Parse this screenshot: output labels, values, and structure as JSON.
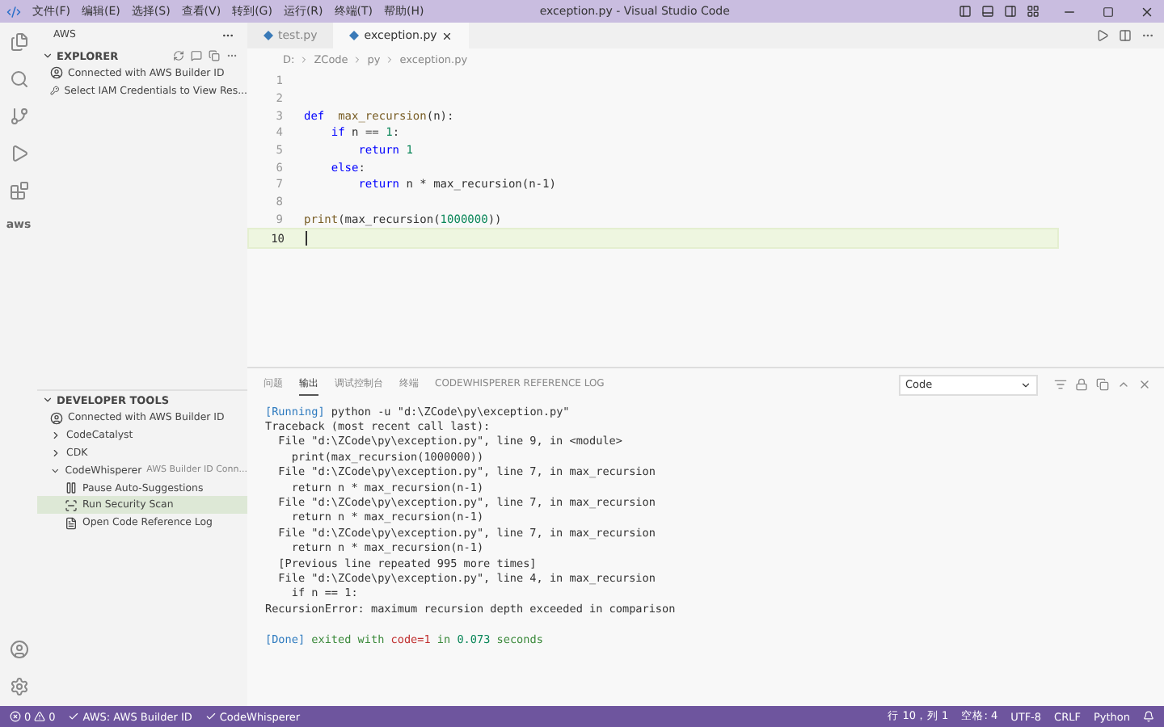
{
  "title_bar": {
    "menus": [
      "文件(F)",
      "编辑(E)",
      "选择(S)",
      "查看(V)",
      "转到(G)",
      "运行(R)",
      "终端(T)",
      "帮助(H)"
    ],
    "title": "exception.py - Visual Studio Code"
  },
  "activity_bar": {
    "aws_label": "aws"
  },
  "sidebar": {
    "title": "AWS",
    "sections": [
      {
        "title": "EXPLORER",
        "expanded": true,
        "items": [
          {
            "kind": "person",
            "label": "Connected with AWS Builder ID",
            "selected": false
          },
          {
            "kind": "key",
            "label": "Select IAM Credentials to View Res...",
            "selected": false
          }
        ]
      },
      {
        "title": "DEVELOPER TOOLS",
        "expanded": true,
        "items": [
          {
            "kind": "person",
            "label": "Connected with AWS Builder ID",
            "selected": false
          },
          {
            "kind": "group",
            "label": "CodeCatalyst",
            "expanded": false,
            "selected": false
          },
          {
            "kind": "group",
            "label": "CDK",
            "expanded": false,
            "selected": false
          },
          {
            "kind": "group",
            "label": "CodeWhisperer",
            "description": "AWS Builder ID Conn...",
            "expanded": true,
            "selected": false,
            "children": [
              {
                "kind": "pause",
                "label": "Pause Auto-Suggestions",
                "selected": false
              },
              {
                "kind": "scan",
                "label": "Run Security Scan",
                "selected": true
              },
              {
                "kind": "log",
                "label": "Open Code Reference Log",
                "selected": false
              }
            ]
          }
        ]
      }
    ]
  },
  "editor": {
    "tabs": [
      {
        "label": "test.py",
        "selected": false
      },
      {
        "label": "exception.py",
        "selected": true
      }
    ],
    "breadcrumb": [
      "D:",
      "ZCode",
      "py",
      "exception.py"
    ],
    "lines": [
      {
        "number": "1",
        "current": false
      },
      {
        "number": "2",
        "current": false
      },
      {
        "number": "3",
        "current": false,
        "tokens": [
          {
            "kind": "keyword",
            "text": "def  "
          },
          {
            "kind": "function",
            "text": "max_recursion"
          },
          {
            "kind": "plain",
            "text": "(n):"
          }
        ]
      },
      {
        "number": "4",
        "current": false,
        "tokens": [
          {
            "kind": "keyword",
            "text": "    if"
          },
          {
            "kind": "plain",
            "text": " n == "
          },
          {
            "kind": "number",
            "text": "1"
          },
          {
            "kind": "plain",
            "text": ":"
          }
        ]
      },
      {
        "number": "5",
        "current": false,
        "tokens": [
          {
            "kind": "keyword",
            "text": "        return"
          },
          {
            "kind": "number",
            "text": " 1"
          }
        ]
      },
      {
        "number": "6",
        "current": false,
        "tokens": [
          {
            "kind": "keyword",
            "text": "    else"
          },
          {
            "kind": "plain",
            "text": ":"
          }
        ]
      },
      {
        "number": "7",
        "current": false,
        "tokens": [
          {
            "kind": "keyword",
            "text": "        return"
          },
          {
            "kind": "plain",
            "text": " n * max_recursion(n-1)"
          }
        ]
      },
      {
        "number": "8",
        "current": false
      },
      {
        "number": "9",
        "current": false,
        "tokens": [
          {
            "kind": "function",
            "text": "print"
          },
          {
            "kind": "plain",
            "text": "(max_recursion("
          },
          {
            "kind": "number",
            "text": "1000000"
          },
          {
            "kind": "plain",
            "text": "))"
          }
        ]
      },
      {
        "number": "10",
        "current": true
      }
    ]
  },
  "panel": {
    "tabs": [
      {
        "label": "问题",
        "selected": false
      },
      {
        "label": "输出",
        "selected": true
      },
      {
        "label": "调试控制台",
        "selected": false
      },
      {
        "label": "终端",
        "selected": false
      },
      {
        "label": "CODEWHISPERER REFERENCE LOG",
        "selected": false
      }
    ],
    "channel_select": "Code",
    "output": [
      [
        {
          "kind": "tag",
          "text": "[Running]"
        },
        {
          "kind": "plain",
          "text": " python -u \"d:\\ZCode\\py\\exception.py\""
        }
      ],
      [
        {
          "kind": "plain",
          "text": "Traceback (most recent call last):"
        }
      ],
      [
        {
          "kind": "plain",
          "text": "  File \"d:\\ZCode\\py\\exception.py\", line 9, in <module>"
        }
      ],
      [
        {
          "kind": "plain",
          "text": "    print(max_recursion(1000000))"
        }
      ],
      [
        {
          "kind": "plain",
          "text": "  File \"d:\\ZCode\\py\\exception.py\", line 7, in max_recursion"
        }
      ],
      [
        {
          "kind": "plain",
          "text": "    return n * max_recursion(n-1)"
        }
      ],
      [
        {
          "kind": "plain",
          "text": "  File \"d:\\ZCode\\py\\exception.py\", line 7, in max_recursion"
        }
      ],
      [
        {
          "kind": "plain",
          "text": "    return n * max_recursion(n-1)"
        }
      ],
      [
        {
          "kind": "plain",
          "text": "  File \"d:\\ZCode\\py\\exception.py\", line 7, in max_recursion"
        }
      ],
      [
        {
          "kind": "plain",
          "text": "    return n * max_recursion(n-1)"
        }
      ],
      [
        {
          "kind": "plain",
          "text": "  [Previous line repeated 995 more times]"
        }
      ],
      [
        {
          "kind": "plain",
          "text": "  File \"d:\\ZCode\\py\\exception.py\", line 4, in max_recursion"
        }
      ],
      [
        {
          "kind": "plain",
          "text": "    if n == 1:"
        }
      ],
      [
        {
          "kind": "plain",
          "text": "RecursionError: maximum recursion depth exceeded in comparison"
        }
      ],
      [
        {
          "kind": "tag",
          "text": "[Done]"
        },
        {
          "kind": "ok",
          "text": " exited with "
        },
        {
          "kind": "error",
          "text": "code=1"
        },
        {
          "kind": "ok",
          "text": " in "
        },
        {
          "kind": "number",
          "text": "0.073"
        },
        {
          "kind": "ok",
          "text": " seconds"
        }
      ]
    ]
  },
  "status_bar": {
    "errors": "0",
    "warnings": "0",
    "left": [
      "AWS: AWS Builder ID",
      "CodeWhisperer"
    ],
    "right": [
      "行 10，列 1",
      "空格: 4",
      "UTF-8",
      "CRLF",
      "Python"
    ]
  }
}
